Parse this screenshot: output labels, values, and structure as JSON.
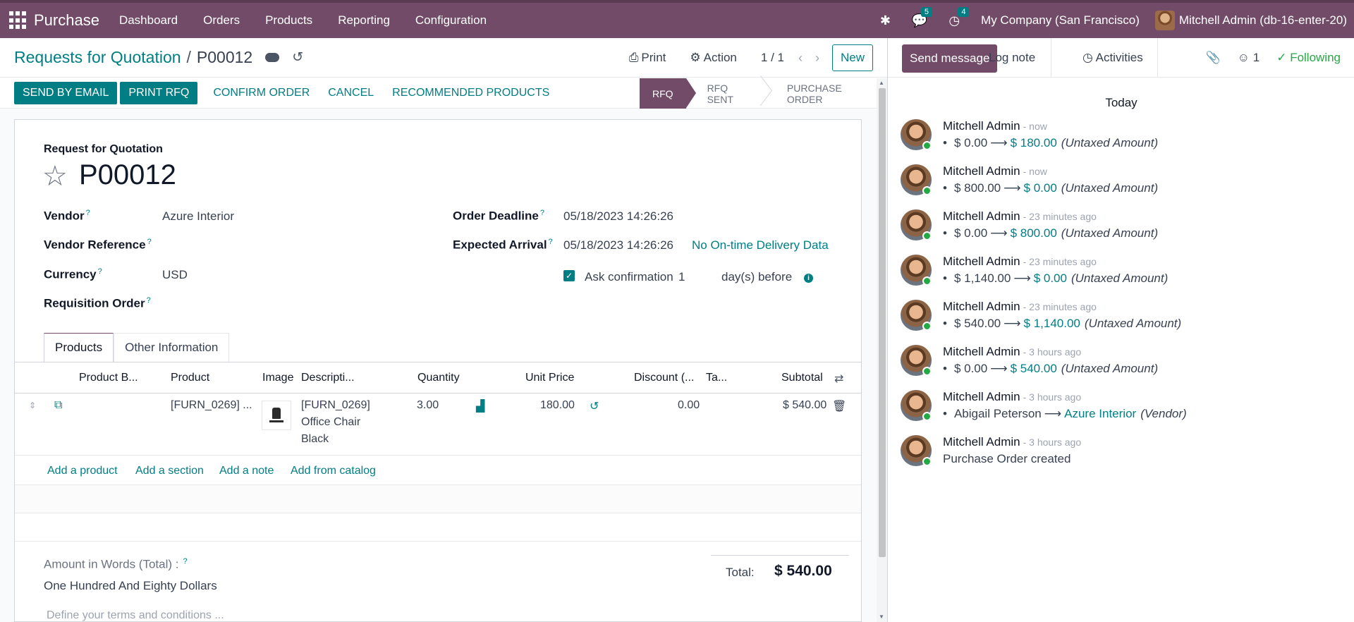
{
  "navbar": {
    "app_name": "Purchase",
    "menu": [
      "Dashboard",
      "Orders",
      "Products",
      "Reporting",
      "Configuration"
    ],
    "messages_badge": "5",
    "activities_badge": "4",
    "company": "My Company (San Francisco)",
    "user": "Mitchell Admin (db-16-enter-20)"
  },
  "control_panel": {
    "breadcrumb_parent": "Requests for Quotation",
    "breadcrumb_current": "P00012",
    "print_label": "Print",
    "action_label": "Action",
    "pager": "1 / 1",
    "new_label": "New"
  },
  "statusbar": {
    "buttons": [
      "SEND BY EMAIL",
      "PRINT RFQ",
      "CONFIRM ORDER",
      "CANCEL",
      "RECOMMENDED PRODUCTS"
    ],
    "stages": [
      "RFQ",
      "RFQ SENT",
      "PURCHASE ORDER"
    ],
    "active_stage": "RFQ"
  },
  "form": {
    "doc_type": "Request for Quotation",
    "name": "P00012",
    "labels": {
      "vendor": "Vendor",
      "vendor_ref": "Vendor Reference",
      "currency": "Currency",
      "requisition": "Requisition Order",
      "order_deadline": "Order Deadline",
      "expected_arrival": "Expected Arrival",
      "ask_confirmation": "Ask confirmation"
    },
    "vendor": "Azure Interior",
    "currency": "USD",
    "order_deadline": "05/18/2023 14:26:26",
    "expected_arrival": "05/18/2023 14:26:26",
    "on_time_link": "No On-time Delivery Data",
    "ask_days": "1",
    "days_before": "day(s) before",
    "help_mark": "?"
  },
  "tabs": [
    "Products",
    "Other Information"
  ],
  "lines_table": {
    "columns": [
      "Product B...",
      "Product",
      "Image",
      "Descripti...",
      "Quantity",
      "Unit Price",
      "Discount (...",
      "Ta...",
      "Subtotal"
    ],
    "rows": [
      {
        "product": "[FURN_0269] ...",
        "desc_1": "[FURN_0269]",
        "desc_2": "Office Chair",
        "desc_3": "Black",
        "quantity": "3.00",
        "unit_price": "180.00",
        "discount": "0.00",
        "subtotal": "$ 540.00"
      }
    ],
    "add_links": [
      "Add a product",
      "Add a section",
      "Add a note",
      "Add from catalog"
    ]
  },
  "footer": {
    "amount_words_label": "Amount in Words (Total) :",
    "amount_words": "One Hundred And Eighty Dollars",
    "terms_placeholder": "Define your terms and conditions ...",
    "total_label": "Total:",
    "total_value": "$ 540.00"
  },
  "chatter": {
    "send_message": "Send message",
    "log_note": "Log note",
    "activities": "Activities",
    "followers_count": "1",
    "following": "Following",
    "today": "Today",
    "messages": [
      {
        "author": "Mitchell Admin",
        "time": "- now",
        "old": "$ 0.00",
        "new": "$ 180.00",
        "field": "(Untaxed Amount)"
      },
      {
        "author": "Mitchell Admin",
        "time": "- now",
        "old": "$ 800.00",
        "new": "$ 0.00",
        "field": "(Untaxed Amount)"
      },
      {
        "author": "Mitchell Admin",
        "time": "- 23 minutes ago",
        "old": "$ 0.00",
        "new": "$ 800.00",
        "field": "(Untaxed Amount)"
      },
      {
        "author": "Mitchell Admin",
        "time": "- 23 minutes ago",
        "old": "$ 1,140.00",
        "new": "$ 0.00",
        "field": "(Untaxed Amount)"
      },
      {
        "author": "Mitchell Admin",
        "time": "- 23 minutes ago",
        "old": "$ 540.00",
        "new": "$ 1,140.00",
        "field": "(Untaxed Amount)"
      },
      {
        "author": "Mitchell Admin",
        "time": "- 3 hours ago",
        "old": "$ 0.00",
        "new": "$ 540.00",
        "field": "(Untaxed Amount)"
      },
      {
        "author": "Mitchell Admin",
        "time": "- 3 hours ago",
        "old": "Abigail Peterson",
        "new": "Azure Interior",
        "field": "(Vendor)"
      },
      {
        "author": "Mitchell Admin",
        "time": "- 3 hours ago",
        "text": "Purchase Order created"
      }
    ]
  },
  "colors": {
    "brand": "#714b67",
    "accent": "#017e84",
    "following": "#28a745"
  }
}
